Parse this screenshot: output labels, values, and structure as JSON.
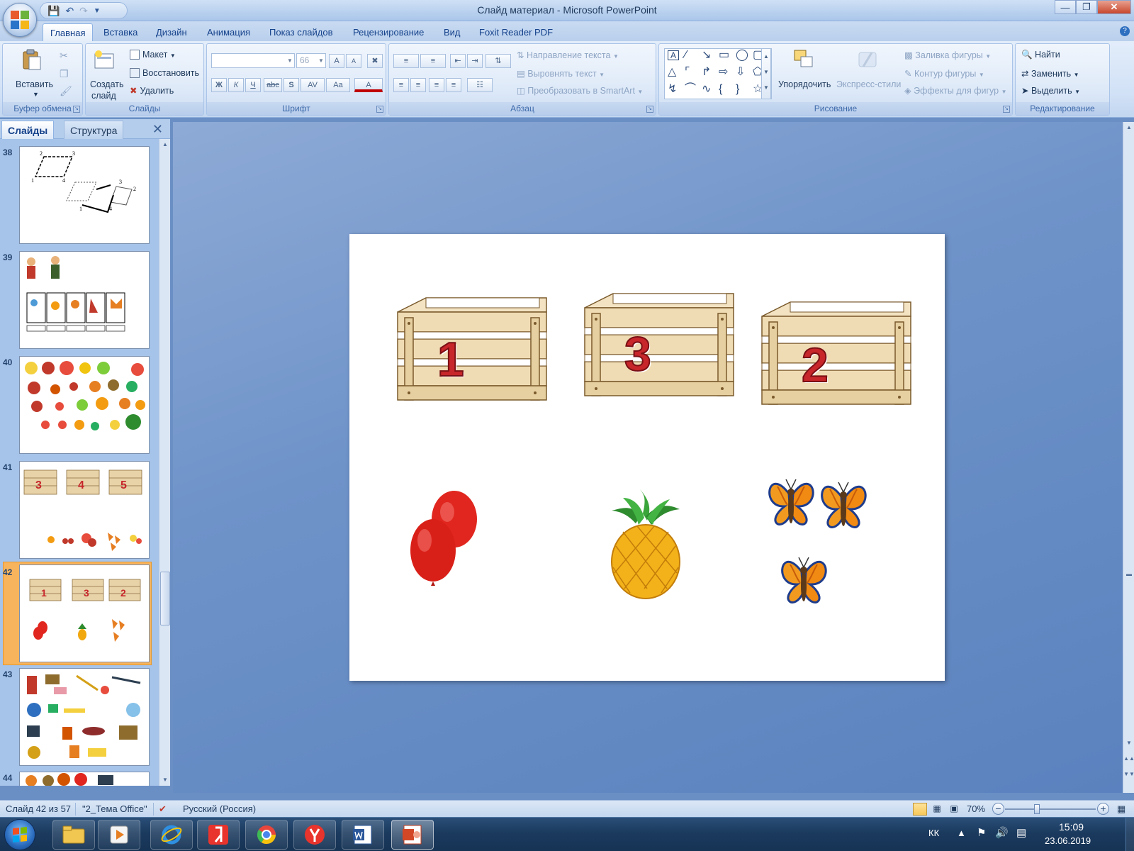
{
  "window": {
    "title": "Слайд материал - Microsoft PowerPoint"
  },
  "tabs": [
    "Главная",
    "Вставка",
    "Дизайн",
    "Анимация",
    "Показ слайдов",
    "Рецензирование",
    "Вид",
    "Foxit Reader PDF"
  ],
  "ribbon": {
    "clipboard": {
      "label": "Буфер обмена",
      "paste": "Вставить"
    },
    "slides": {
      "label": "Слайды",
      "new_slide_line1": "Создать",
      "new_slide_line2": "слайд",
      "layout": "Макет",
      "reset": "Восстановить",
      "delete": "Удалить"
    },
    "font": {
      "label": "Шрифт",
      "font_name": "",
      "font_size": "66",
      "bold": "Ж",
      "italic": "К",
      "underline": "Ч",
      "strike": "abc",
      "shadow": "S",
      "spacing": "AV",
      "case": "Aa",
      "color": "A",
      "grow": "A",
      "shrink": "A"
    },
    "paragraph": {
      "label": "Абзац",
      "text_direction": "Направление текста",
      "align_text": "Выровнять текст",
      "smartart": "Преобразовать в SmartArt"
    },
    "drawing": {
      "label": "Рисование",
      "arrange": "Упорядочить",
      "quick_styles": "Экспресс-стили",
      "fill": "Заливка фигуры",
      "outline": "Контур фигуры",
      "effects": "Эффекты для фигур"
    },
    "editing": {
      "label": "Редактирование",
      "find": "Найти",
      "replace": "Заменить",
      "select": "Выделить"
    }
  },
  "panel": {
    "tab_slides": "Слайды",
    "tab_outline": "Структура",
    "slides": [
      {
        "num": "38"
      },
      {
        "num": "39"
      },
      {
        "num": "40"
      },
      {
        "num": "41"
      },
      {
        "num": "42"
      },
      {
        "num": "43"
      },
      {
        "num": "44"
      }
    ],
    "slide38_labels": [
      "1",
      "2",
      "3",
      "4",
      "1",
      "2",
      "3",
      "4"
    ],
    "slide41_crates": [
      "3",
      "4",
      "5"
    ],
    "slide42_crates": [
      "1",
      "3",
      "2"
    ]
  },
  "slide": {
    "crates": [
      "1",
      "3",
      "2"
    ]
  },
  "status": {
    "slide_info": "Слайд 42 из 57",
    "theme": "\"2_Тема Office\"",
    "language": "Русский (Россия)",
    "zoom": "70%",
    "zoom_fraction": 0.35
  },
  "taskbar": {
    "lang": "КК",
    "time": "15:09",
    "date": "23.06.2019"
  },
  "colors": {
    "crate_number": "#c7262a",
    "selected_slide": "#f8b45c"
  }
}
